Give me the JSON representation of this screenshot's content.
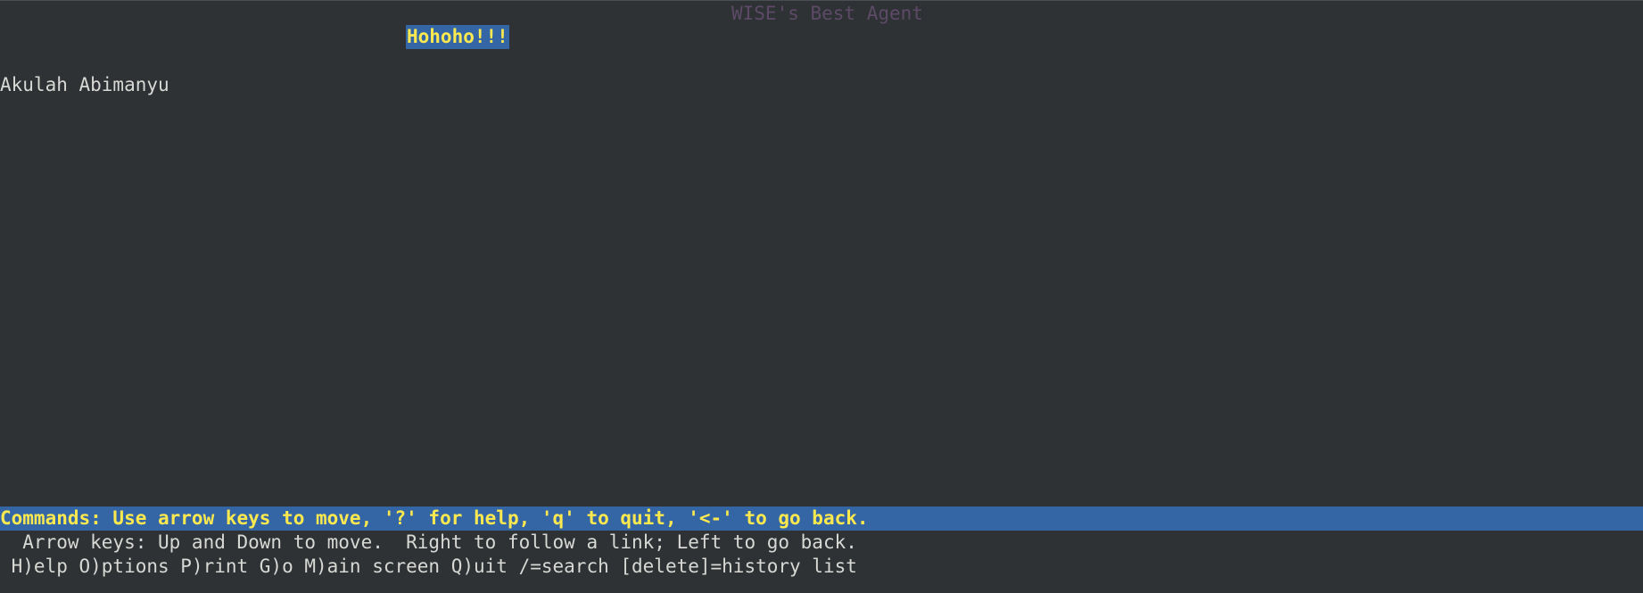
{
  "page": {
    "title": "WISE's Best Agent"
  },
  "content": {
    "selected_link": "Hohoho!!!",
    "text": "Akulah Abimanyu"
  },
  "statusbar": {
    "commands": "Commands: Use arrow keys to move, '?' for help, 'q' to quit, '<-' to go back."
  },
  "help": {
    "line1": "  Arrow keys: Up and Down to move.  Right to follow a link; Left to go back.",
    "line2": " H)elp O)ptions P)rint G)o M)ain screen Q)uit /=search [delete]=history list"
  },
  "colors": {
    "background": "#2e3235",
    "title": "#5c4a66",
    "highlight_bg": "#3465a4",
    "highlight_fg": "#fce94f",
    "text": "#d8d8d4"
  }
}
